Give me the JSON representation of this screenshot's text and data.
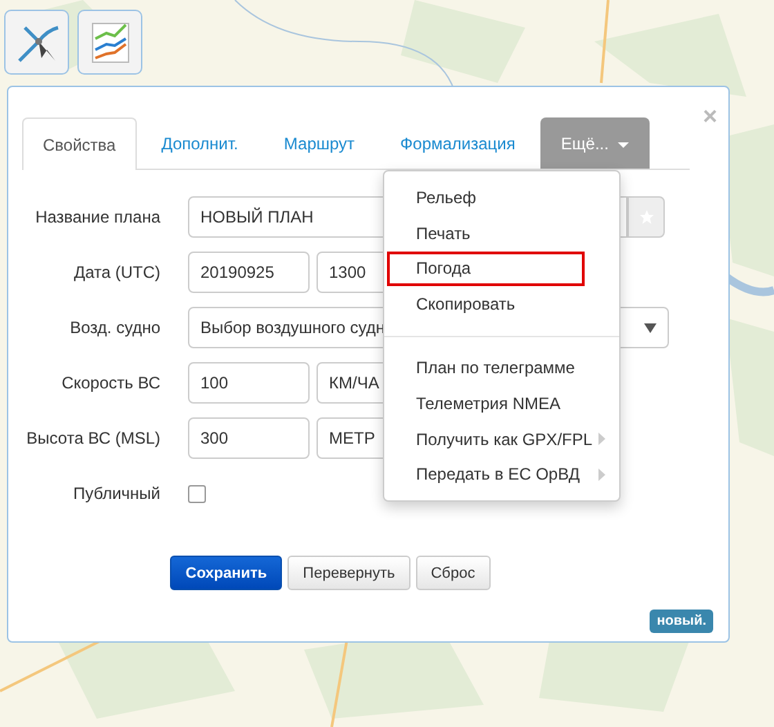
{
  "toolbar": [
    {
      "kind": "route"
    },
    {
      "kind": "chart"
    }
  ],
  "dialog": {
    "close": "×",
    "tabs": [
      {
        "label": "Свойства",
        "selected": true,
        "kind": "tab"
      },
      {
        "label": "Дополнит.",
        "selected": false,
        "kind": "tab"
      },
      {
        "label": "Маршрут",
        "selected": false,
        "kind": "tab"
      },
      {
        "label": "Формализация",
        "selected": false,
        "kind": "tab"
      },
      {
        "label": "Ещё...",
        "selected": false,
        "kind": "dropdown"
      }
    ],
    "fields": [
      {
        "label": "Название плана",
        "kind": "name",
        "value": "НОВЫЙ ПЛАН"
      },
      {
        "label": "Дата (UTC)",
        "kind": "pair",
        "value": "20190925",
        "value_2": "1300"
      },
      {
        "label": "Возд. судно",
        "kind": "select",
        "value": "Выбор воздушного судн"
      },
      {
        "label": "Скорость ВС",
        "kind": "pair",
        "value": "100",
        "value_2": "КМ/ЧА"
      },
      {
        "label": "Высота ВС (MSL)",
        "kind": "pair",
        "value": "300",
        "value_2": "МЕТР"
      },
      {
        "label": "Публичный",
        "kind": "checkbox",
        "checked": false
      }
    ],
    "buttons": [
      {
        "label": "Сохранить",
        "primary": true
      },
      {
        "label": "Перевернуть",
        "primary": false
      },
      {
        "label": "Сброс",
        "primary": false
      }
    ],
    "badge": "новый."
  },
  "menu": {
    "groups": [
      [
        {
          "label": "Рельеф",
          "highlighted": false,
          "submenu": false
        },
        {
          "label": "Печать",
          "highlighted": false,
          "submenu": false
        },
        {
          "label": "Погода",
          "highlighted": true,
          "submenu": false
        },
        {
          "label": "Скопировать",
          "highlighted": false,
          "submenu": false
        }
      ],
      [
        {
          "label": "План по телеграмме",
          "highlighted": false,
          "submenu": false
        },
        {
          "label": "Телеметрия NMEA",
          "highlighted": false,
          "submenu": false
        },
        {
          "label": "Получить как GPX/FPL",
          "highlighted": false,
          "submenu": true
        },
        {
          "label": "Передать в ЕС ОрВД",
          "highlighted": false,
          "submenu": true
        }
      ]
    ]
  }
}
